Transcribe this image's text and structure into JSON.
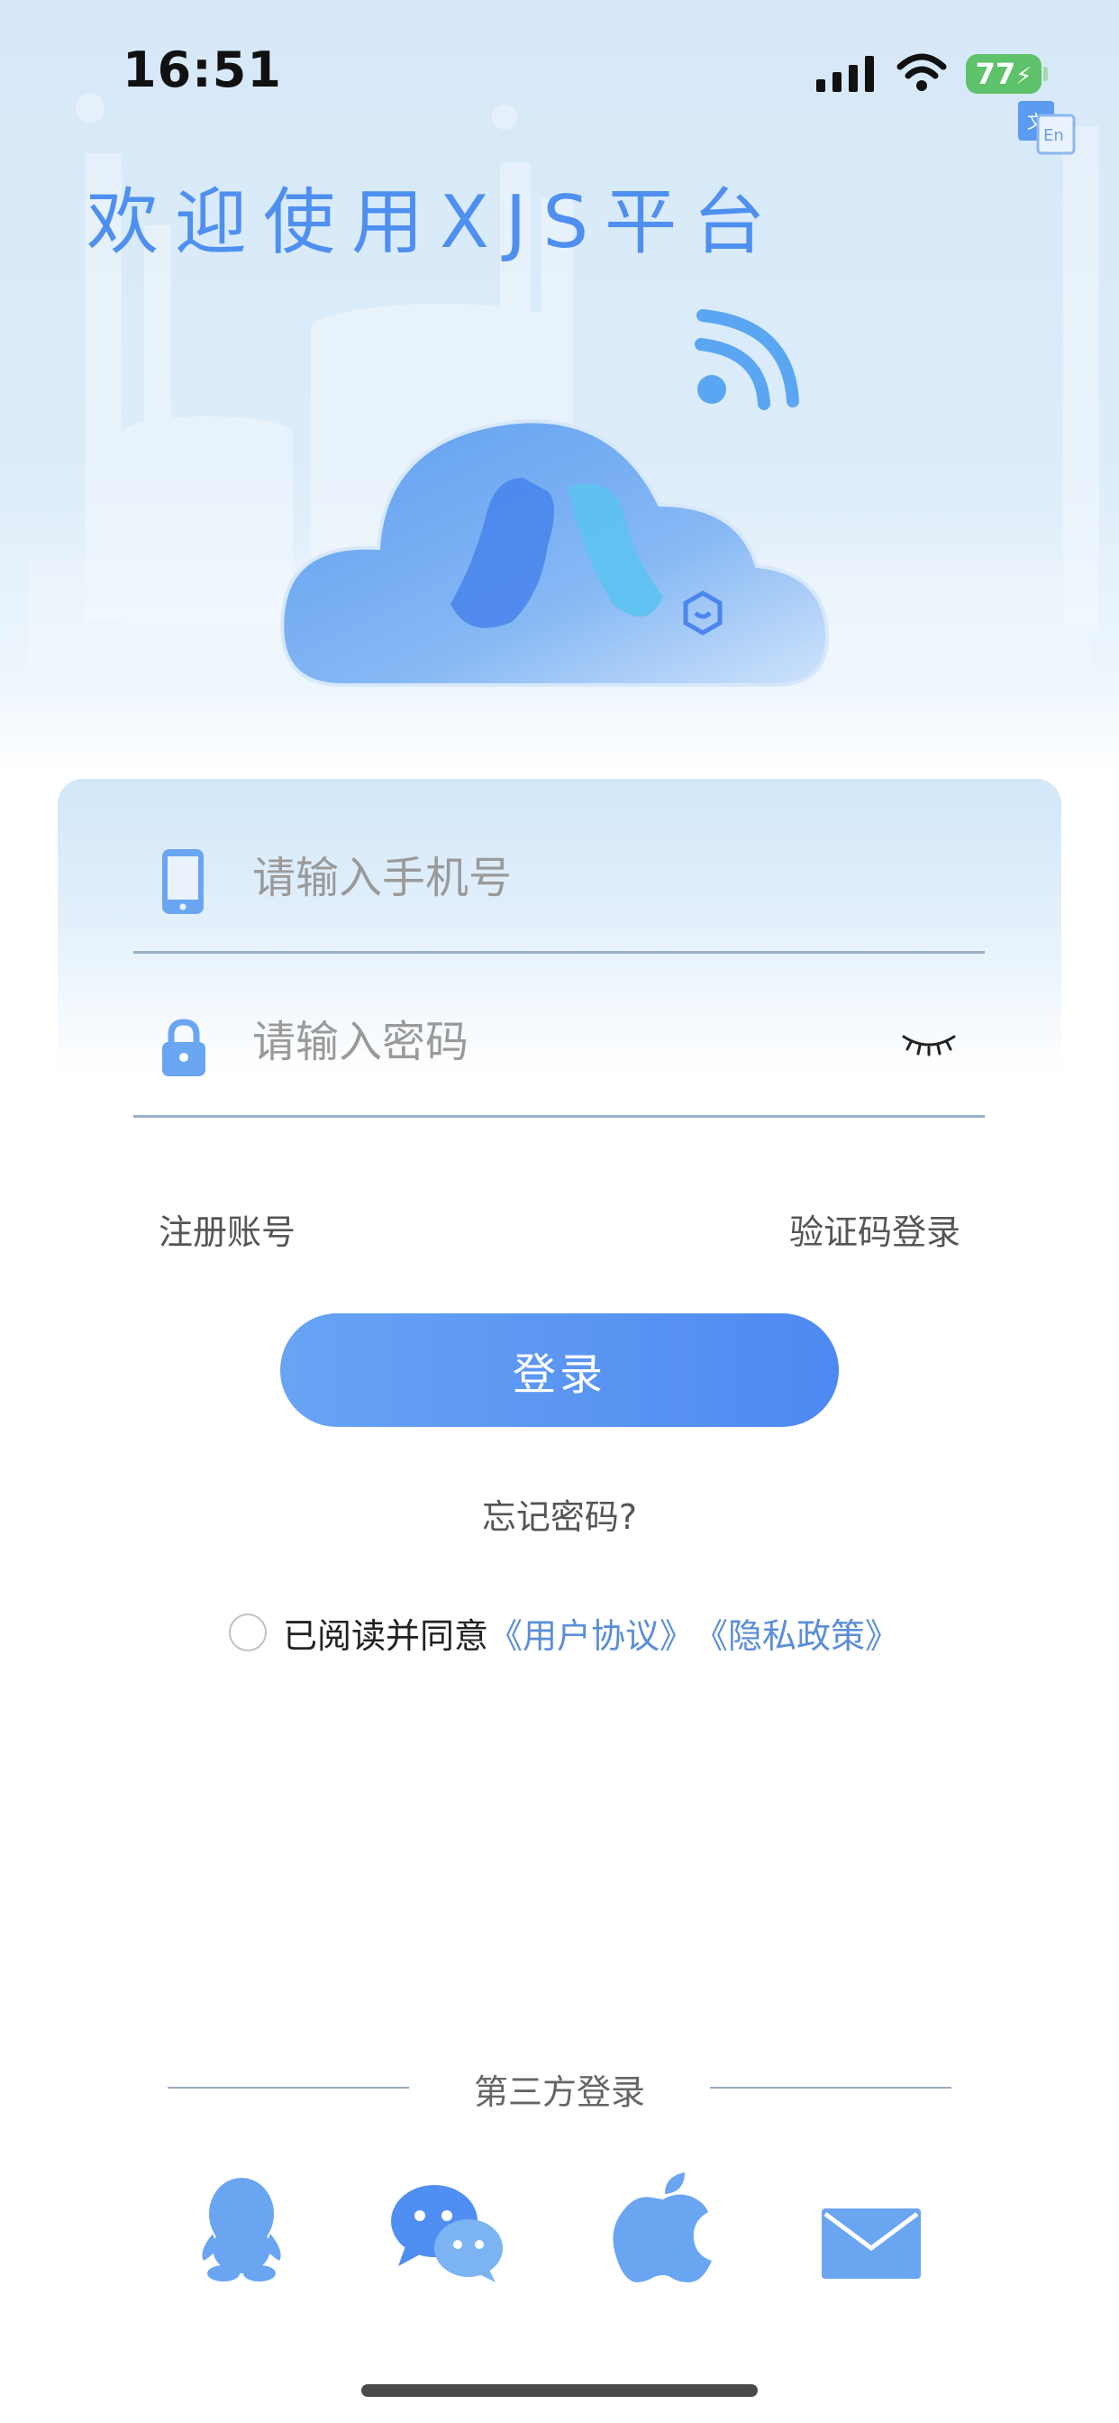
{
  "status_bar": {
    "time": "16:51",
    "battery": "77",
    "icons": [
      "signal-icon",
      "wifi-icon",
      "battery-charging-icon"
    ]
  },
  "header": {
    "title": "欢迎使用XJS平台",
    "language_icon": "language-switch-icon"
  },
  "logo": {
    "icon": "cloud-logo-icon"
  },
  "login_form": {
    "phone_placeholder": "请输入手机号",
    "phone_value": "",
    "password_placeholder": "请输入密码",
    "password_value": "",
    "register_label": "注册账号",
    "sms_login_label": "验证码登录",
    "login_button_label": "登录",
    "forgot_password_label": "忘记密码?",
    "agreement_prefix": "已阅读并同意",
    "user_agreement_label": "《用户协议》",
    "privacy_policy_label": "《隐私政策》",
    "icons": [
      "phone-icon",
      "lock-icon",
      "eye-closed-icon"
    ]
  },
  "third_party": {
    "title": "第三方登录",
    "providers": [
      {
        "name": "QQ",
        "icon": "qq-icon"
      },
      {
        "name": "WeChat",
        "icon": "wechat-icon"
      },
      {
        "name": "Apple",
        "icon": "apple-icon"
      },
      {
        "name": "Email",
        "icon": "email-icon"
      }
    ]
  },
  "colors": {
    "accent": "#4f8ff0",
    "link": "#5a8ed8",
    "icon_blue": "#6aa5f2",
    "battery_green": "#5ec26a"
  }
}
